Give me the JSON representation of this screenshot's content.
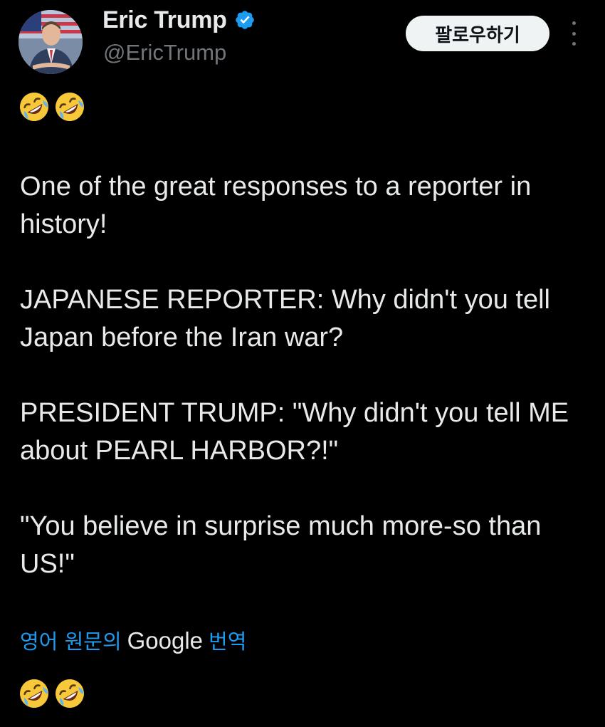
{
  "author": {
    "display_name": "Eric Trump",
    "handle": "@EricTrump",
    "verified": true
  },
  "follow_button": {
    "label": "팔로우하기"
  },
  "tweet": {
    "emoji_prefix": [
      "rofl-emoji",
      "rofl-emoji"
    ],
    "paragraphs": [
      "One of the great responses to a reporter in history!",
      "JAPANESE REPORTER: Why didn't you tell Japan before the Iran war?",
      "PRESIDENT TRUMP: \"Why didn't you tell ME about PEARL HARBOR?!\"",
      "\"You believe in surprise much more-so than US!\""
    ],
    "emoji_suffix": [
      "rofl-emoji",
      "rofl-emoji"
    ]
  },
  "translation": {
    "prefix": "영어 원문의",
    "provider": "Google",
    "suffix": "번역"
  },
  "colors": {
    "background": "#000000",
    "text": "#e7e9ea",
    "secondary_text": "#71767b",
    "link": "#1d9bf0",
    "verified_badge": "#1d9bf0",
    "follow_button_bg": "#eff3f4"
  },
  "icons": {
    "verified": "verified-badge-icon",
    "more": "more-options-icon",
    "emoji": "rolling-on-floor-laughing-emoji"
  }
}
